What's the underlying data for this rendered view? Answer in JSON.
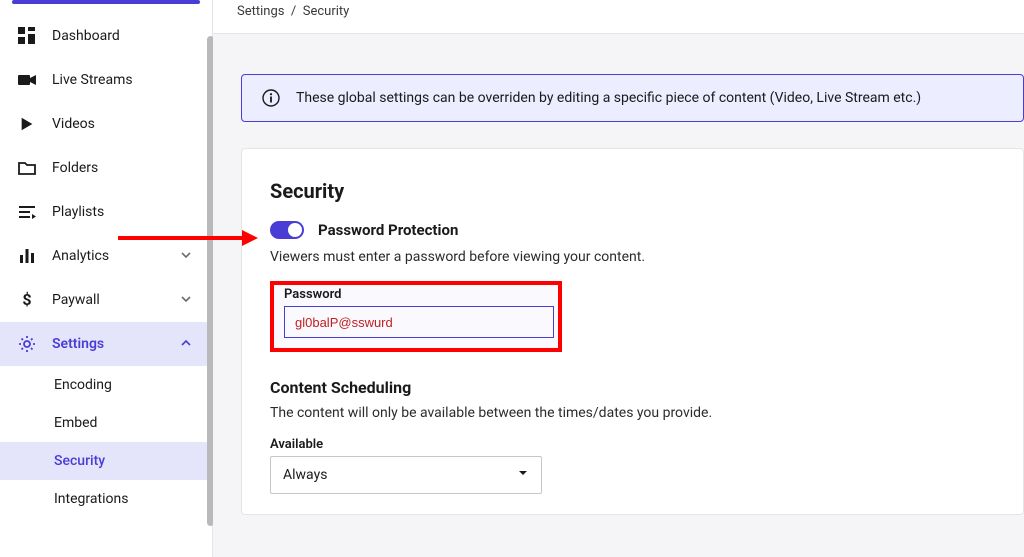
{
  "breadcrumb": {
    "root": "Settings",
    "sep": "/",
    "leaf": "Security"
  },
  "sidebar": {
    "items": [
      {
        "label": "Dashboard"
      },
      {
        "label": "Live Streams"
      },
      {
        "label": "Videos"
      },
      {
        "label": "Folders"
      },
      {
        "label": "Playlists"
      },
      {
        "label": "Analytics"
      },
      {
        "label": "Paywall"
      },
      {
        "label": "Settings"
      }
    ],
    "settings_children": [
      {
        "label": "Encoding"
      },
      {
        "label": "Embed"
      },
      {
        "label": "Security"
      },
      {
        "label": "Integrations"
      }
    ]
  },
  "banner": {
    "text": "These global settings can be overriden by editing a specific piece of content (Video, Live Stream etc.)"
  },
  "security": {
    "heading": "Security",
    "toggle_label": "Password Protection",
    "toggle_on": true,
    "desc": "Viewers must enter a password before viewing your content.",
    "password_label": "Password",
    "password_value": "gl0balP@sswurd"
  },
  "scheduling": {
    "heading": "Content Scheduling",
    "desc": "The content will only be available between the times/dates you provide.",
    "available_label": "Available",
    "available_value": "Always"
  },
  "colors": {
    "accent": "#4a3dd6",
    "highlight": "#ff0000"
  }
}
